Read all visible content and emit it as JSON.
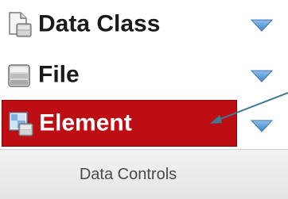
{
  "group": {
    "label": "Data Controls"
  },
  "items": [
    {
      "label": "Data Class",
      "icon": "data-class-icon",
      "expandable": true
    },
    {
      "label": "File",
      "icon": "file-database-icon",
      "expandable": true
    },
    {
      "label": "Element",
      "icon": "element-icon",
      "expandable": true,
      "selected": true
    }
  ],
  "colors": {
    "selected_bg": "#bc0e13",
    "caret": "#5b9bd5",
    "annotation_arrow": "#3c7a94"
  }
}
